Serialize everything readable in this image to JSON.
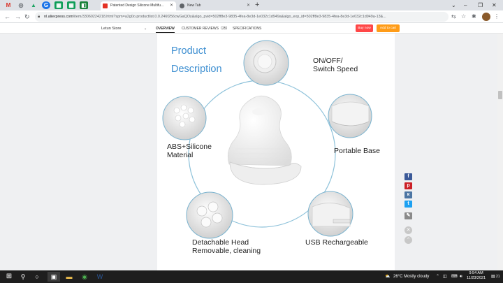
{
  "browser": {
    "pinned_tabs": [
      {
        "icon": "gmail-icon",
        "glyph": "M",
        "color": "#d93025"
      },
      {
        "icon": "chrome-icon",
        "glyph": "◎",
        "color": "#5f6368"
      },
      {
        "icon": "drive-icon",
        "glyph": "▲",
        "color": "#1fa463"
      },
      {
        "icon": "circle-g-icon",
        "glyph": "G",
        "color": "#1a73e8"
      },
      {
        "icon": "sheets-icon",
        "glyph": "▦",
        "color": "#0f9d58"
      },
      {
        "icon": "sheets-icon",
        "glyph": "▦",
        "color": "#0f9d58"
      },
      {
        "icon": "classroom-icon",
        "glyph": "◧",
        "color": "#188038"
      }
    ],
    "tabs": [
      {
        "title": "Patented Design Silicone Multifu...",
        "favicon_color": "#e43225",
        "active": true
      },
      {
        "title": "New Tab",
        "favicon_color": "#5f6368",
        "active": false
      }
    ],
    "new_tab_glyph": "+",
    "window_controls": [
      "⌄",
      "–",
      "❐",
      "✕"
    ],
    "url_host": "nl.aliexpress.com",
    "url_path": "/item/33060224218.html?spm=a2g0o.productlist.0.0.246f256cwGaQOy&algo_pvid=502ff8e3-9835-4fea-8e3d-1e032c1d949a&algo_exp_id=502ff8e3-9835-4fea-8e3d-1e032c1d949a-13&..."
  },
  "sticky_nav": {
    "store_name": "Letun Store",
    "tabs": [
      "OVERVIEW",
      "CUSTOMER REVIEWS（25）",
      "SPECIFICATIONS"
    ],
    "buy_now": "Buy now",
    "add_to_cart": "Add to cart"
  },
  "product_image": {
    "title_line1": "Product",
    "title_line2": "Description",
    "features": {
      "on_off_line1": "ON/OFF/",
      "on_off_line2": "Switch Speed",
      "abs_line1": "ABS+Silicone",
      "abs_line2": "Material",
      "portable": "Portable Base",
      "detachable_line1": "Detachable Head",
      "detachable_line2": "Removable, cleaning",
      "usb": "USB Rechargeable"
    }
  },
  "share": [
    {
      "name": "facebook",
      "glyph": "f",
      "color": "#3b5998"
    },
    {
      "name": "pinterest",
      "glyph": "p",
      "color": "#cb2027"
    },
    {
      "name": "vk",
      "glyph": "к",
      "color": "#4c75a3"
    },
    {
      "name": "twitter",
      "glyph": "t",
      "color": "#1da1f2"
    },
    {
      "name": "edit",
      "glyph": "✎",
      "color": "#8a8a8a"
    }
  ],
  "taskbar": {
    "weather": "26°C  Mostly cloudy",
    "time": "9:54 AM",
    "date": "11/23/2021",
    "notification_count": "21"
  }
}
